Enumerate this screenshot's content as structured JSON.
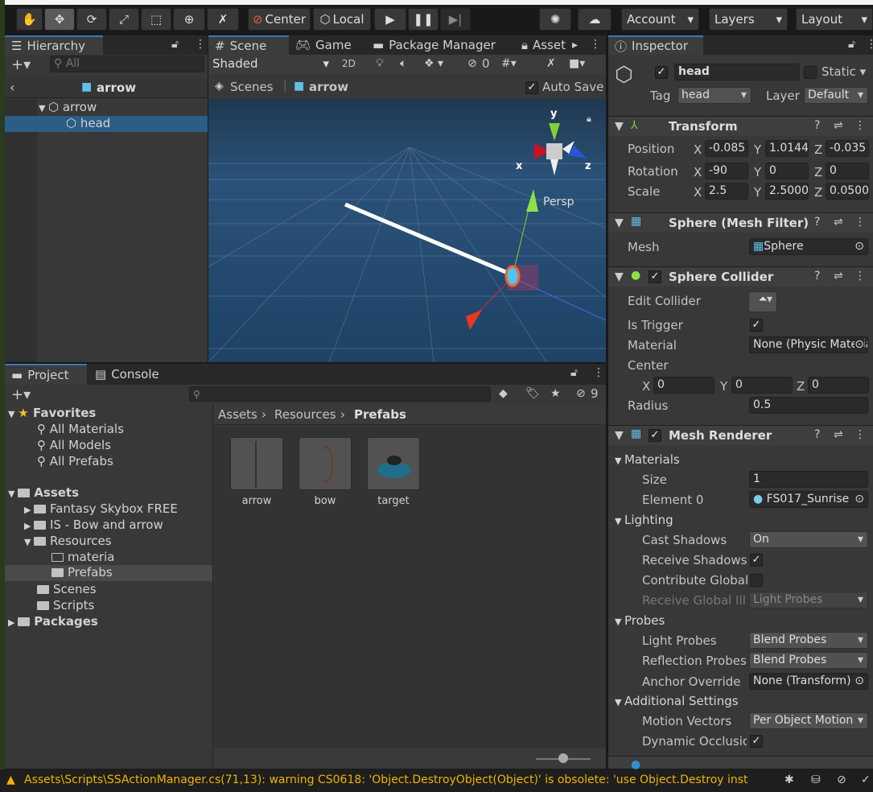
{
  "toolbar": {
    "tools": [
      "hand-tool",
      "move-tool",
      "rotate-tool",
      "scale-tool",
      "rect-tool",
      "transform-tool",
      "custom-tool"
    ],
    "center": "Center",
    "local": "Local",
    "account": "Account",
    "layers": "Layers",
    "layout": "Layout"
  },
  "hierarchy": {
    "tab": "Hierarchy",
    "search_placeholder": "All",
    "breadcrumb": "arrow",
    "items": [
      {
        "label": "arrow"
      },
      {
        "label": "head",
        "selected": true
      }
    ]
  },
  "scene": {
    "tabs": [
      "Scene",
      "Game",
      "Package Manager",
      "Asset"
    ],
    "shading": "Shaded",
    "mode2d": "2D",
    "hidden_count": "0",
    "breadcrumb_root": "Scenes",
    "breadcrumb_item": "arrow",
    "auto_save": "Auto Save",
    "persp": "Persp",
    "axis_x": "x",
    "axis_y": "y",
    "axis_z": "z"
  },
  "project": {
    "tabs": [
      "Project",
      "Console"
    ],
    "hidden_count": "9",
    "favorites": "Favorites",
    "fav_items": [
      "All Materials",
      "All Models",
      "All Prefabs"
    ],
    "assets": "Assets",
    "asset_items": [
      "Fantasy Skybox FREE",
      "IS - Bow and arrow",
      "Resources",
      "materia",
      "Prefabs",
      "Scenes",
      "Scripts"
    ],
    "packages": "Packages",
    "path": [
      "Assets",
      "Resources",
      "Prefabs"
    ],
    "prefabs": [
      "arrow",
      "bow",
      "target"
    ]
  },
  "inspector": {
    "tab": "Inspector",
    "name": "head",
    "static": "Static",
    "tag_label": "Tag",
    "tag": "head",
    "layer_label": "Layer",
    "layer": "Default",
    "transform": {
      "title": "Transform",
      "position": {
        "label": "Position",
        "x": "-0.085",
        "y": "1.0144",
        "z": "-0.035"
      },
      "rotation": {
        "label": "Rotation",
        "x": "-90",
        "y": "0",
        "z": "0"
      },
      "scale": {
        "label": "Scale",
        "x": "2.5",
        "y": "2.5000",
        "z": "0.0500"
      }
    },
    "mesh_filter": {
      "title": "Sphere (Mesh Filter)",
      "mesh_label": "Mesh",
      "mesh": "Sphere"
    },
    "collider": {
      "title": "Sphere Collider",
      "edit": "Edit Collider",
      "is_trigger": "Is Trigger",
      "material_label": "Material",
      "material": "None (Physic Material)",
      "center": "Center",
      "cx": "0",
      "cy": "0",
      "cz": "0",
      "radius_label": "Radius",
      "radius": "0.5"
    },
    "renderer": {
      "title": "Mesh Renderer",
      "materials": "Materials",
      "size_label": "Size",
      "size": "1",
      "element0_label": "Element 0",
      "element0": "FS017_Sunrise",
      "lighting": "Lighting",
      "cast_label": "Cast Shadows",
      "cast": "On",
      "receive": "Receive Shadows",
      "contribute": "Contribute Global",
      "receive_gi_label": "Receive Global Illu",
      "receive_gi": "Light Probes",
      "probes": "Probes",
      "light_probes_label": "Light Probes",
      "light_probes": "Blend Probes",
      "reflection_label": "Reflection Probes",
      "reflection": "Blend Probes",
      "anchor_label": "Anchor Override",
      "anchor": "None (Transform)",
      "additional": "Additional Settings",
      "motion_label": "Motion Vectors",
      "motion": "Per Object Motion",
      "dynamic": "Dynamic Occlusion"
    },
    "axis": {
      "x": "X",
      "y": "Y",
      "z": "Z"
    }
  },
  "status": {
    "message": "Assets\\Scripts\\SSActionManager.cs(71,13): warning CS0618: 'Object.DestroyObject(Object)' is obsolete: 'use Object.Destroy inst",
    "color": "#f0b400"
  }
}
